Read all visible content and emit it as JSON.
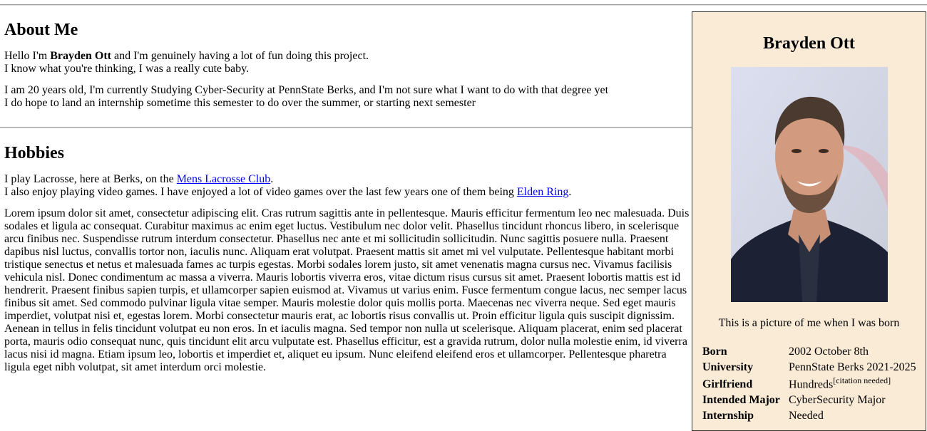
{
  "about": {
    "heading": "About Me",
    "intro_pre": "Hello I'm ",
    "intro_name": "Brayden Ott",
    "intro_post": " and I'm genuinely having a lot of fun doing this project.",
    "intro_line2": "I know what you're thinking, I was a really cute baby.",
    "para2_line1": "I am 20 years old, I'm currently Studying Cyber-Security at PennState Berks, and I'm not sure what I want to do with that degree yet",
    "para2_line2": "I do hope to land an internship sometime this semester to do over the summer, or starting next semester"
  },
  "hobbies": {
    "heading": "Hobbies",
    "line1_pre": "I play Lacrosse, here at Berks, on the ",
    "line1_link": "Mens Lacrosse Club",
    "line1_post": ".",
    "line2_pre": "I also enjoy playing video games. I have enjoyed a lot of video games over the last few years one of them being ",
    "line2_link": "Elden Ring",
    "line2_post": ".",
    "lorem": "Lorem ipsum dolor sit amet, consectetur adipiscing elit. Cras rutrum sagittis ante in pellentesque. Mauris efficitur fermentum leo nec malesuada. Duis sodales et ligula ac consequat. Curabitur maximus ac enim eget luctus. Vestibulum nec dolor velit. Phasellus tincidunt rhoncus libero, in scelerisque arcu finibus nec. Suspendisse rutrum interdum consectetur. Phasellus nec ante et mi sollicitudin sollicitudin. Nunc sagittis posuere nulla. Praesent dapibus nisl luctus, convallis tortor non, iaculis nunc. Aliquam erat volutpat. Praesent mattis sit amet mi vel vulputate. Pellentesque habitant morbi tristique senectus et netus et malesuada fames ac turpis egestas. Morbi sodales lorem justo, sit amet venenatis magna cursus nec. Vivamus facilisis vehicula nisl. Donec condimentum ac massa a viverra. Mauris lobortis viverra eros, vitae dictum risus cursus sit amet. Praesent lobortis mattis est id hendrerit. Praesent finibus sapien turpis, et ullamcorper sapien euismod at. Vivamus ut varius enim. Fusce fermentum congue lacus, nec semper lacus finibus sit amet. Sed commodo pulvinar ligula vitae semper. Mauris molestie dolor quis mollis porta. Maecenas nec viverra neque. Sed eget mauris imperdiet, volutpat nisi et, egestas lorem. Morbi consectetur mauris erat, ac lobortis risus convallis ut. Proin efficitur ligula quis suscipit dignissim. Aenean in tellus in felis tincidunt volutpat eu non eros. In et iaculis magna. Sed tempor non nulla ut scelerisque. Aliquam placerat, enim sed placerat porta, mauris odio consequat nunc, quis tincidunt elit arcu vulputate est. Phasellus efficitur, est a gravida rutrum, dolor nulla molestie enim, id viverra lacus nisi id magna. Etiam ipsum leo, lobortis et imperdiet et, aliquet eu ipsum. Nunc eleifend eleifend eros et ullamcorper. Pellentesque pharetra ligula eget nibh volutpat, sit amet interdum orci molestie."
  },
  "infobox": {
    "title": "Brayden Ott",
    "caption": "This is a picture of me when I was born",
    "background": "#faebd7",
    "rows": [
      {
        "key": "Born",
        "value": "2002 October 8th"
      },
      {
        "key": "University",
        "value": "PennState Berks 2021-2025"
      },
      {
        "key": "Girlfriend",
        "value": "Hundreds",
        "sup": "[citation needed]"
      },
      {
        "key": "Intended Major",
        "value": "CyberSecurity Major"
      },
      {
        "key": "Internship",
        "value": "Needed"
      }
    ]
  }
}
